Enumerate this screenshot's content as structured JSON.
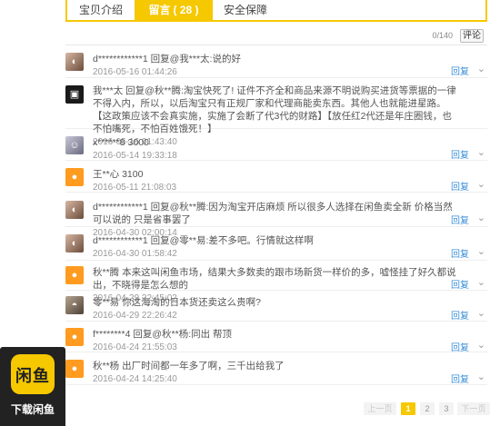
{
  "tabs": [
    {
      "label": "宝贝介绍",
      "count": ""
    },
    {
      "label": "留言",
      "count": "( 28 )"
    },
    {
      "label": "安全保障",
      "count": ""
    }
  ],
  "comment_box": {
    "counter": "0/140",
    "submit_label": "评论"
  },
  "comments": [
    {
      "text": "d************1  回复@我***太:说的好",
      "time": "2016-05-16 01:44:26",
      "reply": "回复",
      "avatar": "girl-avatar"
    },
    {
      "text": "我***太  回复@秋**腾:淘宝快死了! 证件不齐全和商品来源不明说购买进货等票据的一律不得入内，所以，以后淘宝只有正规厂家和代理商能卖东西。其他人也就能进星路。【这政策应该不会真实施，实施了会断了代3代的财路】【放任红2代还是年庄圈钱，也不怕嘴死，不怕百姓饿死！】",
      "time": "2016-05-16 01:43:40",
      "reply": "",
      "avatar": "dark-avatar"
    },
    {
      "text": "x******8  3000",
      "time": "2016-05-14 19:33:18",
      "reply": "回复",
      "avatar": "face-avatar"
    },
    {
      "text": "王**心  3100",
      "time": "2016-05-11 21:08:03",
      "reply": "回复",
      "avatar": "orange-avatar"
    },
    {
      "text": "d************1  回复@秋**腾:因为淘宝开店麻烦 所以很多人选择在闲鱼卖全新 价格当然可以说的 只是省事罢了",
      "time": "2016-04-30 02:00:14",
      "reply": "回复",
      "avatar": "girl-avatar"
    },
    {
      "text": "d************1  回复@零**易:差不多吧。行情就这样啊",
      "time": "2016-04-30 01:58:42",
      "reply": "回复",
      "avatar": "girl-avatar"
    },
    {
      "text": "秋**腾  本来这叫闲鱼市场，结果大多数卖的跟市场新货一样价的多，嘘怪挂了好久都说出，不晓得是怎么想的",
      "time": "2016-04-29 22:45:02",
      "reply": "回复",
      "avatar": "orange-avatar"
    },
    {
      "text": "零**易  你这海淘的日本货还卖这么贵啊?",
      "time": "2016-04-29 22:26:42",
      "reply": "回复",
      "avatar": "cat-avatar"
    },
    {
      "text": "f********4  回复@秋**杨:同出 帮顶",
      "time": "2016-04-24 21:55:03",
      "reply": "回复",
      "avatar": "orange-avatar"
    },
    {
      "text": "秋**杨  出厂时间都一年多了啊，三千出给我了",
      "time": "2016-04-24 14:25:40",
      "reply": "回复",
      "avatar": "orange-avatar"
    }
  ],
  "pager": {
    "prev": "上一页",
    "pages": [
      "1",
      "2",
      "3"
    ],
    "next": "下一页",
    "current": "1"
  },
  "app_banner": {
    "logo_text": "闲鱼",
    "cta": "下载闲鱼"
  }
}
